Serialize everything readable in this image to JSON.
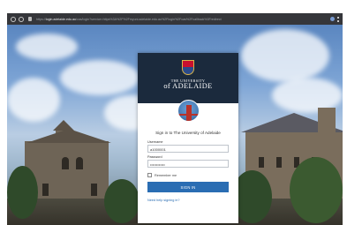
{
  "browser": {
    "url_prefix": "https://",
    "url_host": "login.adelaide.edu.au",
    "url_path": "/cas/login?service=https%3A%2F%2Fmyuni.adelaide.edu.au%2Flogin%2Fcas%2Fcallback%3Fredirect"
  },
  "card": {
    "brand_small": "THE UNIVERSITY",
    "brand_big": "of ADELAIDE",
    "title": "Sign in to The University of Adelaide",
    "username_label": "Username",
    "username_value": "a1000001",
    "password_label": "Password",
    "password_value": "••••••••••••",
    "remember_label": "Remember me",
    "signin_label": "SIGN IN",
    "help_label": "Need help signing in?"
  },
  "colors": {
    "header": "#1b2a3d",
    "button": "#2a6db3"
  },
  "icons": {
    "crest": "university-crest-icon",
    "avatar": "bridge-avatar-icon"
  }
}
